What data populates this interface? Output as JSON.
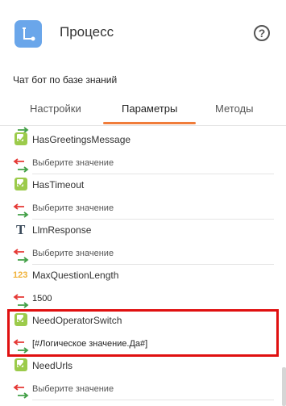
{
  "header": {
    "title": "Процесс",
    "help_icon": "?"
  },
  "subtitle": "Чат бот по базе знаний",
  "tabs": [
    {
      "label": "Настройки",
      "active": false
    },
    {
      "label": "Параметры",
      "active": true
    },
    {
      "label": "Методы",
      "active": false
    }
  ],
  "params": [
    {
      "name": "HasGreetingsMessage",
      "type_icon": "checkbox-icon",
      "value": "Выберите значение",
      "placeholder": true
    },
    {
      "name": "HasTimeout",
      "type_icon": "checkbox-icon",
      "value": "Выберите значение",
      "placeholder": true
    },
    {
      "name": "LlmResponse",
      "type_icon": "text-type-icon",
      "value": "Выберите значение",
      "placeholder": true
    },
    {
      "name": "MaxQuestionLength",
      "type_icon": "number-type-icon",
      "type_icon_text": "123",
      "value": "1500",
      "placeholder": false
    },
    {
      "name": "NeedOperatorSwitch",
      "type_icon": "checkbox-icon",
      "value": "[#Логическое значение.Да#]",
      "placeholder": false,
      "highlighted": true
    },
    {
      "name": "NeedUrls",
      "type_icon": "checkbox-icon",
      "value": "Выберите значение",
      "placeholder": true
    }
  ],
  "colors": {
    "accent": "#f07c3a",
    "highlight": "#e01010",
    "checkbox": "#9ccb4b",
    "icon_bg": "#6aa6ea",
    "arrow_in": "#e53935",
    "arrow_out": "#43a047"
  }
}
